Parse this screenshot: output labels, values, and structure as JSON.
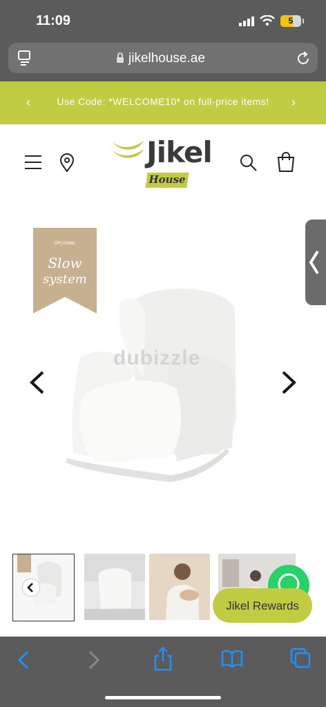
{
  "status_bar": {
    "time": "11:09",
    "battery": "5"
  },
  "browser": {
    "url": "jikelhouse.ae"
  },
  "promo": {
    "text": "Use Code: *WELCOME10* on full-price items!"
  },
  "header": {
    "logo_word": "Jikel",
    "logo_sub": "House"
  },
  "product": {
    "tag_small": "· OPCIONAL ·",
    "tag_line1": "Slow",
    "tag_line2": "system",
    "watermark": "dubizzle"
  },
  "rewards": {
    "label": "Jikel Rewards"
  },
  "colors": {
    "accent": "#c2cc43",
    "chrome": "#5b5b5b",
    "link": "#1e90ff"
  },
  "icons": [
    "reader-icon",
    "lock-icon",
    "reload-icon",
    "menu-icon",
    "location-icon",
    "search-icon",
    "cart-icon",
    "chevron-left-icon",
    "chevron-right-icon",
    "whatsapp-icon",
    "share-icon",
    "bookmarks-icon",
    "tabs-icon"
  ]
}
